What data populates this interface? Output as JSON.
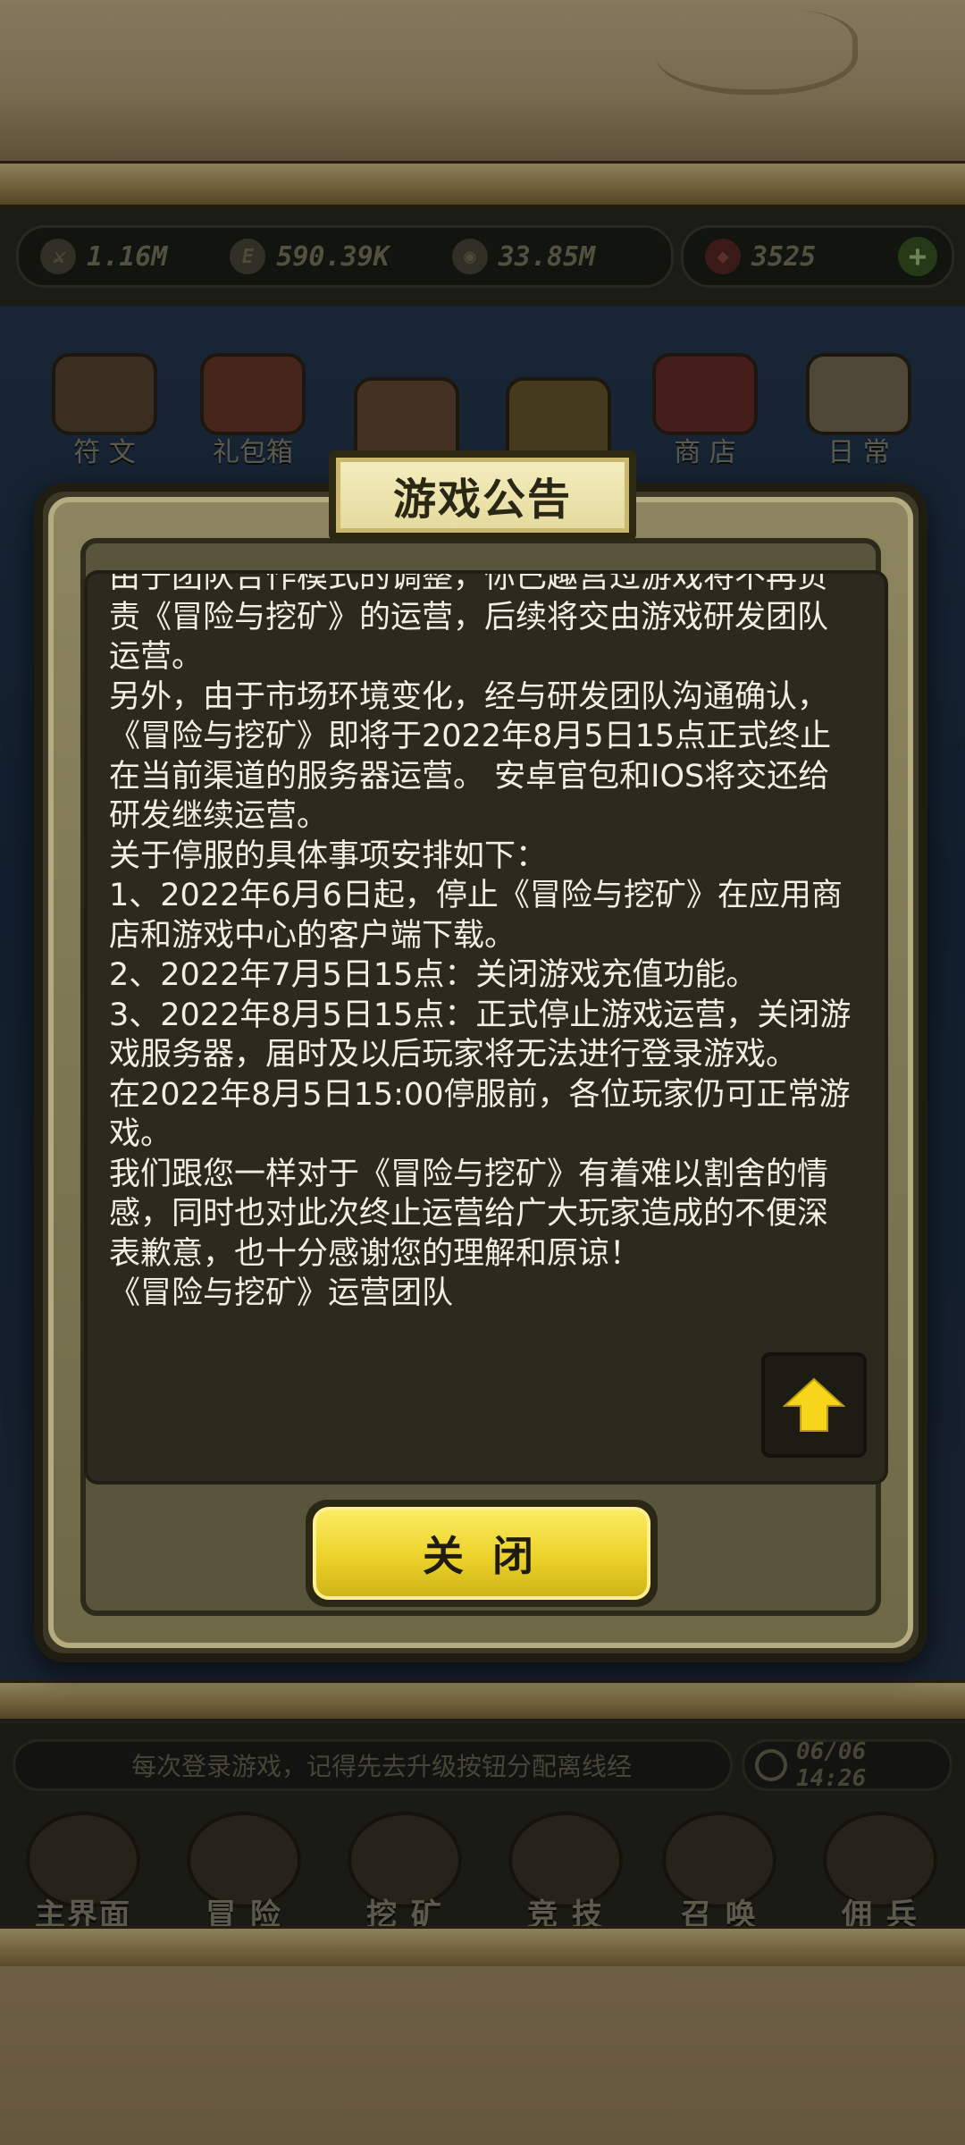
{
  "resources": {
    "attack": "1.16M",
    "exp": "590.39K",
    "gold": "33.85M",
    "gems": "3525"
  },
  "top_nav": [
    "符 文",
    "礼包箱",
    "",
    "",
    "商 店",
    "日 常"
  ],
  "dialog": {
    "title": "游戏公告",
    "paragraphs": [
      "由于团队合作模式的调整，你已趣宫过游戏将不再负责《冒险与挖矿》的运营，后续将交由游戏研发团队运营。",
      "另外，由于市场环境变化，经与研发团队沟通确认，《冒险与挖矿》即将于2022年8月5日15点正式终止在当前渠道的服务器运营。 安卓官包和IOS将交还给研发继续运营。",
      "关于停服的具体事项安排如下：",
      "1、2022年6月6日起，停止《冒险与挖矿》在应用商店和游戏中心的客户端下载。",
      "2、2022年7月5日15点：关闭游戏充值功能。",
      "3、2022年8月5日15点：正式停止游戏运营，关闭游戏服务器，届时及以后玩家将无法进行登录游戏。",
      "在2022年8月5日15:00停服前，各位玩家仍可正常游戏。",
      "我们跟您一样对于《冒险与挖矿》有着难以割舍的情感，同时也对此次终止运营给广大玩家造成的不便深表歉意，也十分感谢您的理解和原谅！",
      "《冒险与挖矿》运营团队"
    ],
    "close_label": "关 闭"
  },
  "footer": {
    "tip": "每次登录游戏，记得先去升级按钮分配离线经",
    "time": "06/06 14:26",
    "nav": [
      "主界面",
      "冒 险",
      "挖 矿",
      "竞 技",
      "召 唤",
      "佣 兵"
    ]
  },
  "colors": {
    "accent": "#ecd22a",
    "panel": "#59553c",
    "text": "#f1efe4"
  }
}
